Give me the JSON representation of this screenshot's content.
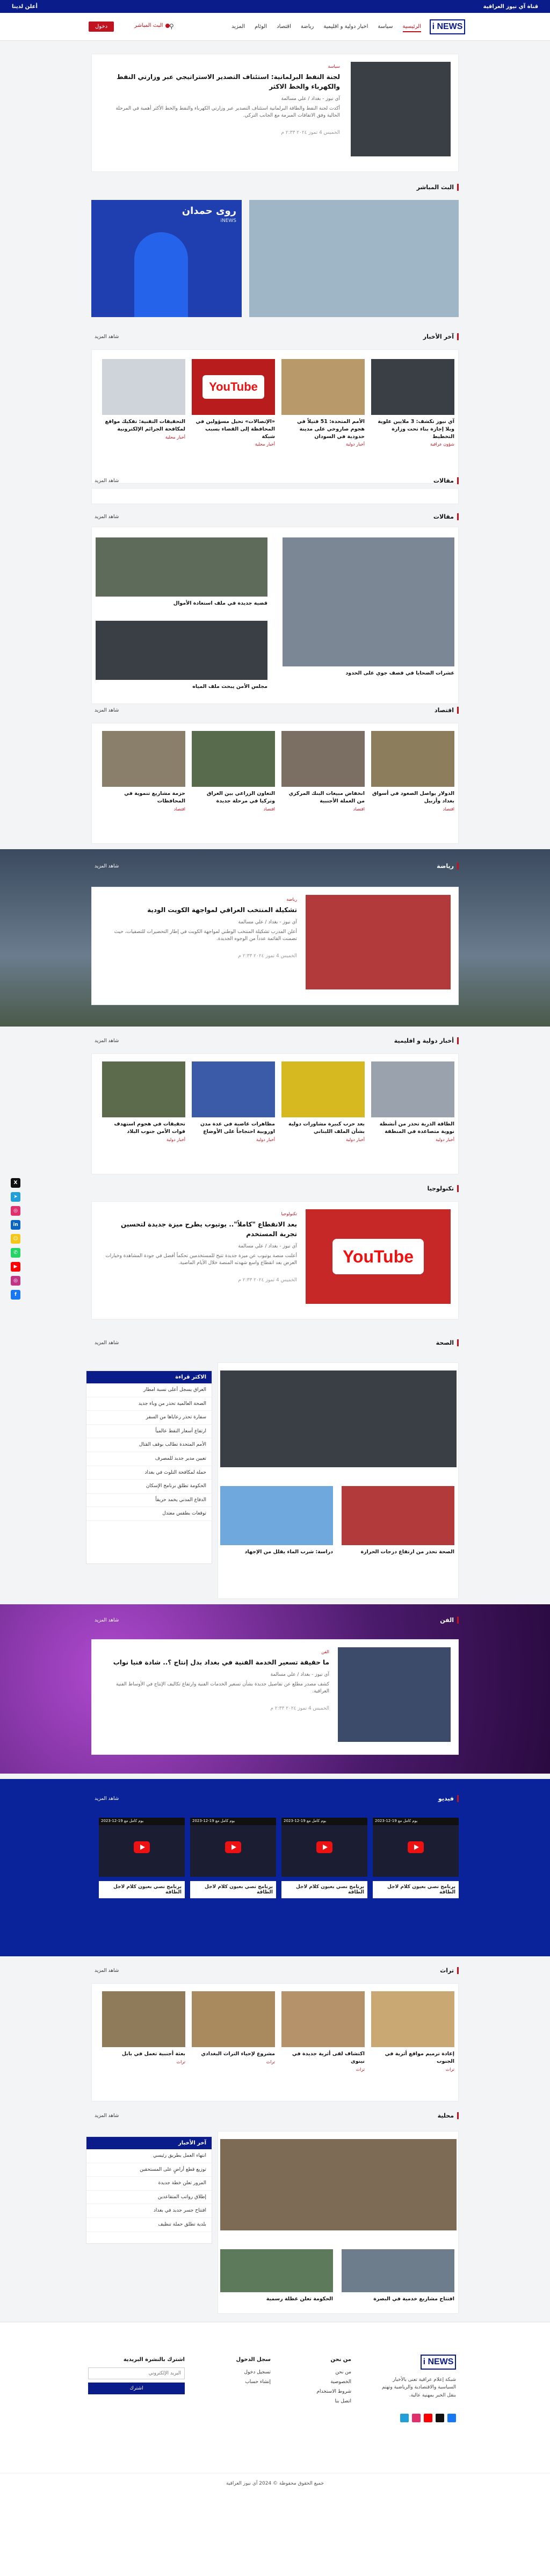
{
  "topbar": {
    "right": "قناة آي نيوز العراقية",
    "left": "أعلن لدينا"
  },
  "nav": {
    "logo": "i NEWS",
    "items": [
      "الرئيسية",
      "سياسة",
      "اخبار دولية و اقليمية",
      "رياضة",
      "اقتصاد",
      "الوئام",
      "المزيد"
    ],
    "live": "البث المباشر",
    "search_icon": "search-icon",
    "login": "دخول"
  },
  "hero": {
    "category": "سياسة",
    "title": "لجنة النفط البرلمانية: استئناف التصدير الاستراتيجي عبر وزارتي النفط والكهرباء والخط الاكثر",
    "author": "آي نيوز - بغداد / علي مسالمة",
    "excerpt": "أكدت لجنة النفط والطاقة البرلمانية استئناف التصدير عبر وزارتي الكهرباء والنفط والخط الأكثر أهمية في المرحلة الحالية وفق الاتفاقات المبرمة مع الجانب التركي.",
    "date": "الخميس 4 تموز ٢٠٢٤ ٢:٣٣ م"
  },
  "live": {
    "header": "البث المباشر",
    "anchor": "روى حمدان",
    "channel": "iNEWS"
  },
  "latest": {
    "header": "آخر الأخبار",
    "more": "شاهد المزيد",
    "items": [
      {
        "title": "آي نيوز تكشف: 3 ملايين علوية وبلا إجازة بناء تحت وزارة التخطيط",
        "cat": "شؤون عراقية"
      },
      {
        "title": "الأمم المتحدة: 51 قتيلاً في هجوم صاروخي على مدينة حدودية في السودان",
        "cat": "أخبار دولية"
      },
      {
        "title": "«الإتصالات» تحيل مسؤولين في المحافظة إلى القضاء بسبب شبكة",
        "cat": "أخبار محلية"
      },
      {
        "title": "التحقيقات التقنية: تفكيك مواقع لمكافحة الجرائم الإلكترونية",
        "cat": "أخبار محلية"
      }
    ]
  },
  "ads": {
    "header": "مقالات",
    "more": "شاهد المزيد"
  },
  "politics": {
    "header": "مقالات",
    "more": "شاهد المزيد",
    "main": "عشرات الضحايا في قصف جوي على الحدود",
    "side1": "قضية جديدة في ملف استعادة الأموال",
    "side2": "مجلس الأمن يبحث ملف المياه"
  },
  "economy": {
    "header": "اقتصاد",
    "more": "شاهد المزيد",
    "items": [
      {
        "title": "الدولار يواصل الصعود في أسواق بغداد وأربيل",
        "cat": "اقتصاد"
      },
      {
        "title": "انخفاض مبيعات البنك المركزي من العملة الأجنبية",
        "cat": "اقتصاد"
      },
      {
        "title": "التعاون الزراعي بين العراق وتركيا في مرحلة جديدة",
        "cat": "اقتصاد"
      },
      {
        "title": "حزمة مشاريع تنموية في المحافظات",
        "cat": "اقتصاد"
      }
    ]
  },
  "sports": {
    "header": "رياضة",
    "more": "شاهد المزيد",
    "category": "رياضة",
    "title": "تشكيلة المنتخب العراقي لمواجهة الكويت الودية",
    "author": "آي نيوز - بغداد / علي مسالمة",
    "excerpt": "أعلن المدرب تشكيلة المنتخب الوطني لمواجهة الكويت في إطار التحضيرات للتصفيات، حيث تضمنت القائمة عدداً من الوجوه الجديدة.",
    "date": "الخميس 4 تموز ٢٠٢٤ ٢:٣٣ م"
  },
  "intl": {
    "header": "أخبار دولية و اقليمية",
    "more": "شاهد المزيد",
    "items": [
      {
        "title": "الطاقة الذرية تحذر من أنشطة نووية متصاعدة في المنطقة",
        "cat": "أخبار دولية"
      },
      {
        "title": "بعد حرب كبيرة مشاورات دولية بشأن الملف اللبناني",
        "cat": "أخبار دولية"
      },
      {
        "title": "مظاهرات غاضبة في عدة مدن اوروبية احتجاجاً على الأوضاع",
        "cat": "أخبار دولية"
      },
      {
        "title": "تحقيقات في هجوم استهدف قوات الأمن جنوب البلاد",
        "cat": "أخبار دولية"
      }
    ]
  },
  "tech": {
    "header": "تكنولوجيا",
    "category": "تكنولوجيا",
    "title": "بعد الانقطاع \"كاملاً\".. يوتيوب يطرح ميزة جديدة لتحسين تجربة المستخدم",
    "author": "آي نيوز - بغداد / علي مسالمة",
    "excerpt": "أعلنت منصة يوتيوب عن ميزة جديدة تتيح للمستخدمين تحكماً أفضل في جودة المشاهدة وخيارات العرض بعد انقطاع واسع شهدته المنصة خلال الأيام الماضية.",
    "date": "الخميس 4 تموز ٢٠٢٤ ٢:٣٣ م",
    "yt": "YouTube"
  },
  "health": {
    "header": "الصحة",
    "more": "شاهد المزيد",
    "side1": "الصحة تحذر من ارتفاع درجات الحرارة",
    "side2": "دراسة: شرب الماء يقلل من الإجهاد",
    "list_head": "الاكثر قراءة",
    "list": [
      "العراق يسجل أعلى نسبة امطار",
      "الصحة العالمية تحذر من وباء جديد",
      "سفارة تحذر رعاياها من السفر",
      "ارتفاع أسعار النفط عالمياً",
      "الأمم المتحدة تطالب بوقف القتال",
      "تعيين مدير جديد للمصرف",
      "حملة لمكافحة التلوث في بغداد",
      "الحكومة تطلق برنامج الإسكان",
      "الدفاع المدني يخمد حريقاً",
      "توقعات بطقس معتدل"
    ]
  },
  "art": {
    "header": "الفن",
    "more": "شاهد المزيد",
    "category": "الفن",
    "title": "ما حقيقة تسعير الخدمة الفنية في بغداد بدل إنتاج ؟.. شادة فنيا نواب",
    "author": "آي نيوز - بغداد / علي مسالمة",
    "excerpt": "كشف مصدر مطلع عن تفاصيل جديدة بشأن تسعير الخدمات الفنية وارتفاع تكاليف الإنتاج في الأوساط الفنية العراقية.",
    "date": "الخميس 4 تموز ٢٠٢٤ ٢:٣٣ م"
  },
  "videos": {
    "header": "فيديو",
    "more": "شاهد المزيد",
    "items": [
      {
        "bar": "2023-12-19 يوم كامل مع",
        "title": "برنامج نصي بعيون كلام لاجل الطاقة"
      },
      {
        "bar": "2023-12-19 يوم كامل مع",
        "title": "برنامج نصي بعيون كلام لاجل الطاقة"
      },
      {
        "bar": "2023-12-19 يوم كامل مع",
        "title": "برنامج نصي بعيون كلام لاجل الطاقة"
      },
      {
        "bar": "2023-12-19 يوم كامل مع",
        "title": "برنامج نصي بعيون كلام لاجل الطاقة"
      }
    ]
  },
  "heritage": {
    "header": "تراث",
    "more": "شاهد المزيد",
    "items": [
      {
        "title": "إعادة ترميم مواقع أثرية في الجنوب",
        "cat": "تراث"
      },
      {
        "title": "اكتشاف لقى أثرية جديدة في نينوى",
        "cat": "تراث"
      },
      {
        "title": "مشروع لإحياء التراث البغدادي",
        "cat": "تراث"
      },
      {
        "title": "بعثة أجنبية تعمل في بابل",
        "cat": "تراث"
      }
    ]
  },
  "local": {
    "header": "محلية",
    "more": "شاهد المزيد",
    "side1": "افتتاح مشاريع خدمية في البصرة",
    "side2": "الحكومة تعلن عطلة رسمية",
    "list_head": "آخر الأخبار",
    "list": [
      "انتهاء العمل بطريق رئيسي",
      "توزيع قطع أراضٍ على المستحقين",
      "المرور تعلن خطة جديدة",
      "إطلاق رواتب المتقاعدين",
      "افتتاح جسر جديد في بغداد",
      "بلدية تطلق حملة تنظيف"
    ]
  },
  "footer": {
    "logo": "i NEWS",
    "about": "شبكة إعلام عراقية تعنى بالأخبار السياسية والاقتصادية والرياضية وتهتم بنقل الخبر بمهنية عالية.",
    "col_about": "من نحن",
    "col_about_items": [
      "من نحن",
      "الخصوصية",
      "شروط الاستخدام",
      "اتصل بنا"
    ],
    "col_reg": "سجل الدخول",
    "reg_items": [
      "تسجيل دخول",
      "إنشاء حساب"
    ],
    "col_news": "اشترك بالنشرة البريدية",
    "subscribe": "اشترك",
    "email_placeholder": "البريد الإلكتروني",
    "copy": "جميع الحقوق محفوظة © 2024 آي نيوز العراقية"
  },
  "colors": {
    "primary": "#0a1c8a",
    "accent": "#c1121f"
  }
}
